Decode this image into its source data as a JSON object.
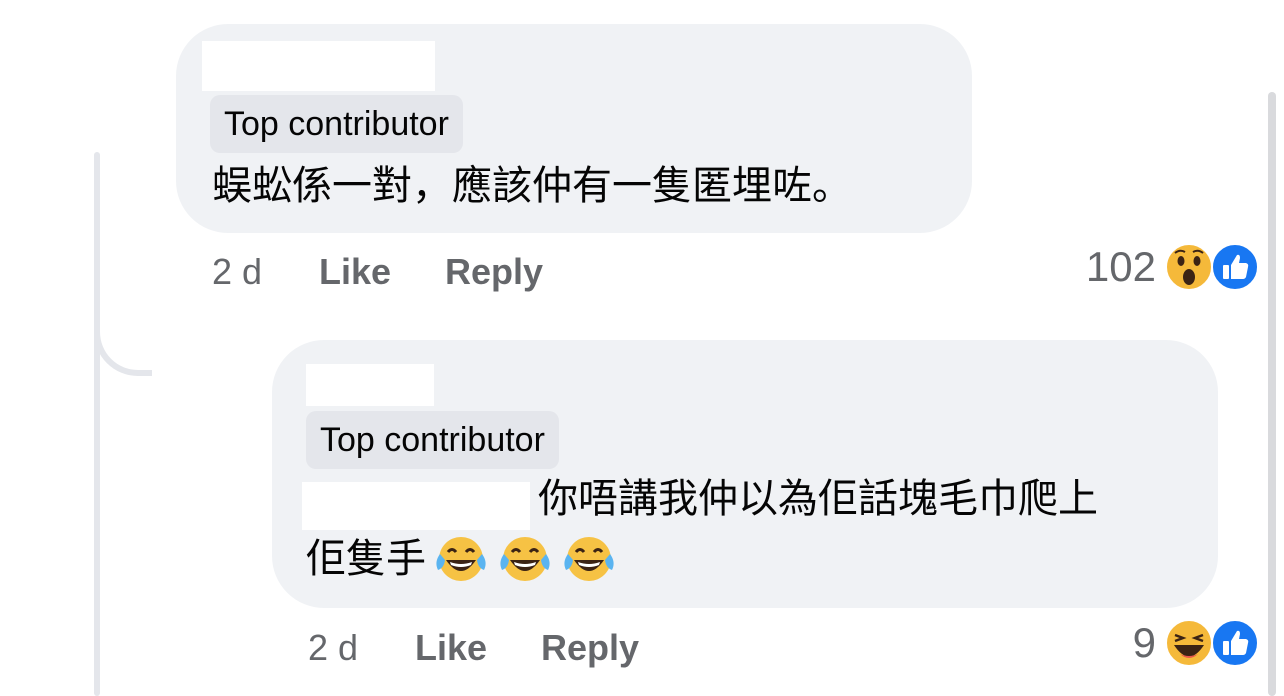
{
  "comment": {
    "badge": "Top contributor",
    "text": "蜈蚣係一對，應該仲有一隻匿埋咗。",
    "time": "2 d",
    "like_label": "Like",
    "reply_label": "Reply",
    "reaction_count": "102",
    "reaction_icons": [
      "wow-icon",
      "like-icon"
    ]
  },
  "reply": {
    "badge": "Top contributor",
    "text_line1": "你唔講我仲以為佢話塊毛巾爬上",
    "text_line2": "佢隻手",
    "emojis": [
      "laughing-tears-icon",
      "laughing-tears-icon",
      "laughing-tears-icon"
    ],
    "time": "2 d",
    "like_label": "Like",
    "reply_label": "Reply",
    "reaction_count": "9",
    "reaction_icons": [
      "haha-icon",
      "like-icon"
    ]
  },
  "colors": {
    "bubble": "#f0f2f5",
    "badge": "#e4e6eb",
    "secondary_text": "#65676b",
    "like_blue": "#1877f2"
  }
}
